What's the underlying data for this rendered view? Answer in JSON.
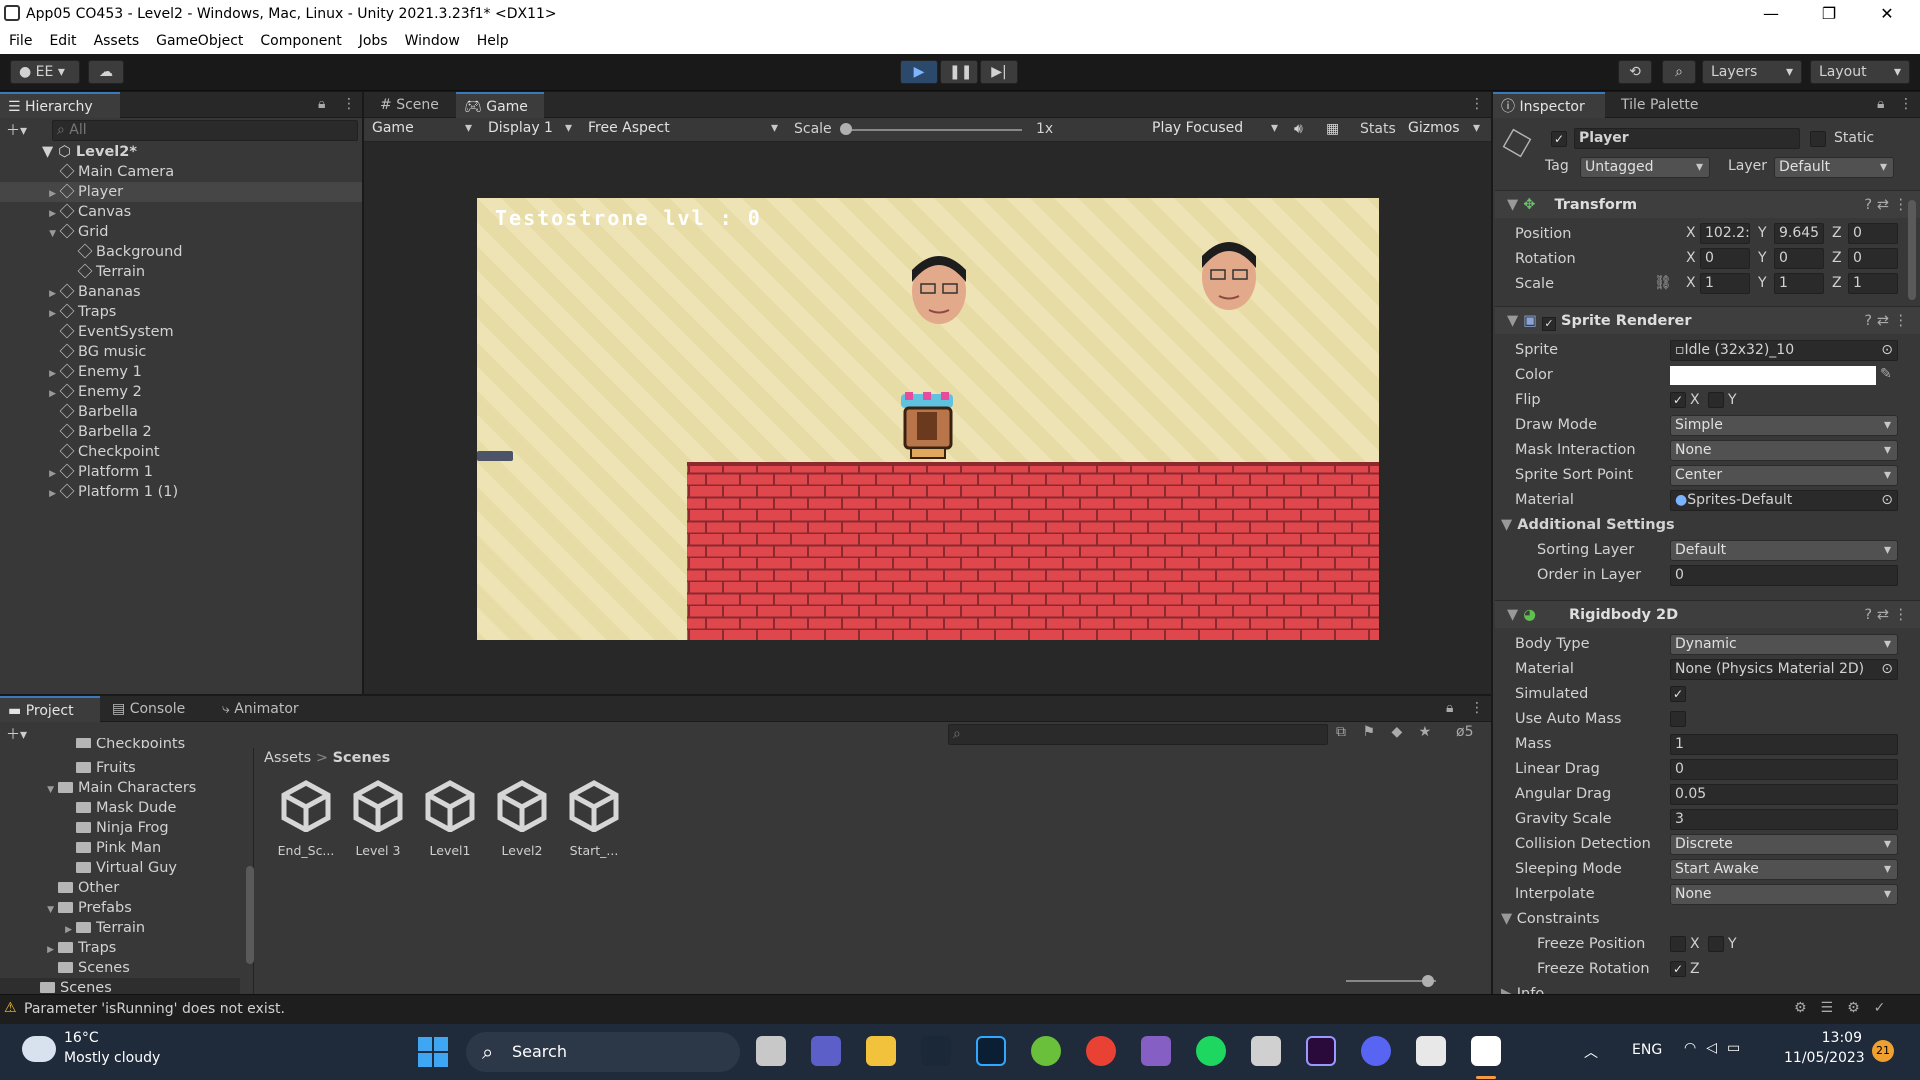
{
  "window": {
    "title": "App05 CO453 - Level2 - Windows, Mac, Linux - Unity 2021.3.23f1* <DX11>",
    "min": "—",
    "max": "❐",
    "close": "✕"
  },
  "menu": [
    "File",
    "Edit",
    "Assets",
    "GameObject",
    "Component",
    "Jobs",
    "Window",
    "Help"
  ],
  "toolbar": {
    "account": "EE",
    "layers": "Layers",
    "layout": "Layout"
  },
  "hierarchy": {
    "tab": "Hierarchy",
    "search_placeholder": "All",
    "scene": "Level2*",
    "items": [
      {
        "label": "Main Camera",
        "depth": 1,
        "arrow": ""
      },
      {
        "label": "Player",
        "depth": 1,
        "arrow": "▶",
        "selected": true
      },
      {
        "label": "Canvas",
        "depth": 1,
        "arrow": "▶"
      },
      {
        "label": "Grid",
        "depth": 1,
        "arrow": "▼"
      },
      {
        "label": "Background",
        "depth": 2,
        "arrow": ""
      },
      {
        "label": "Terrain",
        "depth": 2,
        "arrow": ""
      },
      {
        "label": "Bananas",
        "depth": 1,
        "arrow": "▶"
      },
      {
        "label": "Traps",
        "depth": 1,
        "arrow": "▶"
      },
      {
        "label": "EventSystem",
        "depth": 1,
        "arrow": ""
      },
      {
        "label": "BG music",
        "depth": 1,
        "arrow": ""
      },
      {
        "label": "Enemy 1",
        "depth": 1,
        "arrow": "▶"
      },
      {
        "label": "Enemy 2",
        "depth": 1,
        "arrow": "▶"
      },
      {
        "label": "Barbella",
        "depth": 1,
        "arrow": ""
      },
      {
        "label": "Barbella 2",
        "depth": 1,
        "arrow": ""
      },
      {
        "label": "Checkpoint",
        "depth": 1,
        "arrow": ""
      },
      {
        "label": "Platform 1",
        "depth": 1,
        "arrow": "▶"
      },
      {
        "label": "Platform 1 (1)",
        "depth": 1,
        "arrow": "▶"
      }
    ]
  },
  "view_tabs": {
    "scene": "Scene",
    "game": "Game"
  },
  "game_bar": {
    "mode": "Game",
    "display": "Display 1",
    "aspect": "Free Aspect",
    "scale_label": "Scale",
    "scale_value": "1x",
    "play_focused": "Play Focused",
    "stats": "Stats",
    "gizmos": "Gizmos"
  },
  "game_view": {
    "hud": "Testostrone lvl : 0",
    "sky_color": "#e8dca6",
    "brick_color": "#e0474c"
  },
  "bottom_tabs": {
    "project": "Project",
    "console": "Console",
    "animator": "Animator",
    "hidden_count": "5"
  },
  "project_tree": [
    {
      "label": "Checkpoints",
      "depth": 3
    },
    {
      "label": "Fruits",
      "depth": 3
    },
    {
      "label": "Main Characters",
      "depth": 2,
      "arrow": "▼"
    },
    {
      "label": "Mask Dude",
      "depth": 3
    },
    {
      "label": "Ninja Frog",
      "depth": 3
    },
    {
      "label": "Pink Man",
      "depth": 3
    },
    {
      "label": "Virtual Guy",
      "depth": 3
    },
    {
      "label": "Other",
      "depth": 2
    },
    {
      "label": "Prefabs",
      "depth": 2,
      "arrow": "▼"
    },
    {
      "label": "Terrain",
      "depth": 3,
      "arrow": "▶"
    },
    {
      "label": "Traps",
      "depth": 2,
      "arrow": "▶"
    },
    {
      "label": "Scenes",
      "depth": 2
    },
    {
      "label": "Scenes",
      "depth": 1
    }
  ],
  "breadcrumb": {
    "root": "Assets",
    "current": "Scenes"
  },
  "assets": [
    "End_Sc...",
    "Level 3",
    "Level1",
    "Level2",
    "Start_..."
  ],
  "inspector": {
    "tab": "Inspector",
    "tab2": "Tile Palette",
    "object_name": "Player",
    "static_label": "Static",
    "tag_label": "Tag",
    "tag": "Untagged",
    "layer_label": "Layer",
    "layer": "Default",
    "transform": {
      "title": "Transform",
      "position_label": "Position",
      "pos_x": "102.2:",
      "pos_y": "9.645",
      "pos_z": "0",
      "rotation_label": "Rotation",
      "rot_x": "0",
      "rot_y": "0",
      "rot_z": "0",
      "scale_label": "Scale",
      "scl_x": "1",
      "scl_y": "1",
      "scl_z": "1",
      "x": "X",
      "y": "Y",
      "z": "Z"
    },
    "sprite_renderer": {
      "title": "Sprite Renderer",
      "sprite_label": "Sprite",
      "sprite": "Idle (32x32)_10",
      "color_label": "Color",
      "flip_label": "Flip",
      "flip_x": "X",
      "flip_y": "Y",
      "draw_mode_label": "Draw Mode",
      "draw_mode": "Simple",
      "mask_label": "Mask Interaction",
      "mask": "None",
      "sort_point_label": "Sprite Sort Point",
      "sort_point": "Center",
      "material_label": "Material",
      "material": "Sprites-Default",
      "additional": "Additional Settings",
      "sorting_layer_label": "Sorting Layer",
      "sorting_layer": "Default",
      "order_label": "Order in Layer",
      "order": "0"
    },
    "rigidbody": {
      "title": "Rigidbody 2D",
      "body_type_label": "Body Type",
      "body_type": "Dynamic",
      "material_label": "Material",
      "material": "None (Physics Material 2D)",
      "simulated_label": "Simulated",
      "auto_mass_label": "Use Auto Mass",
      "mass_label": "Mass",
      "mass": "1",
      "linear_drag_label": "Linear Drag",
      "linear_drag": "0",
      "angular_drag_label": "Angular Drag",
      "angular_drag": "0.05",
      "gravity_label": "Gravity Scale",
      "gravity": "3",
      "collision_label": "Collision Detection",
      "collision": "Discrete",
      "sleeping_label": "Sleeping Mode",
      "sleeping": "Start Awake",
      "interpolate_label": "Interpolate",
      "interpolate": "None",
      "constraints_label": "Constraints",
      "freeze_pos_label": "Freeze Position",
      "freeze_rot_label": "Freeze Rotation",
      "fx": "X",
      "fy": "Y",
      "fz": "Z",
      "info": "Info"
    }
  },
  "status": {
    "message": "Parameter 'isRunning' does not exist."
  },
  "taskbar": {
    "temp": "16°C",
    "weather": "Mostly cloudy",
    "search": "Search",
    "lang": "ENG",
    "time": "13:09",
    "date": "11/05/2023",
    "notif": "21"
  }
}
